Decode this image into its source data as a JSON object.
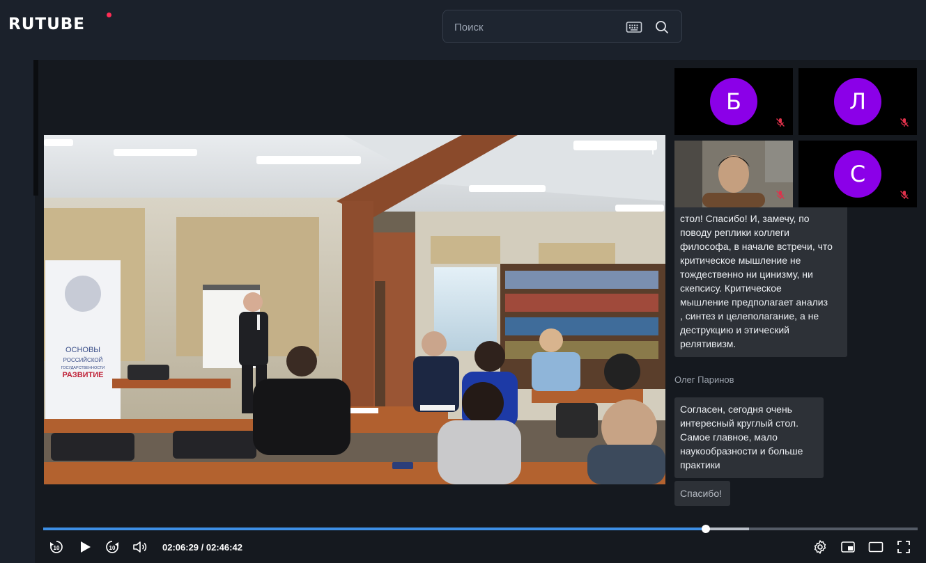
{
  "header": {
    "logo_text": "RUTUBE",
    "search_placeholder": "Поиск"
  },
  "participants": [
    {
      "initial": "Б",
      "muted": true
    },
    {
      "initial": "Л",
      "muted": true
    },
    {
      "initial": "",
      "muted": true,
      "has_video": true
    },
    {
      "initial": "С",
      "muted": true
    }
  ],
  "chat": {
    "messages": [
      {
        "lines": [
          "стол! Спасибо! И,  замечу, по",
          "поводу реплики коллеги",
          "философа, в начале встречи, что",
          "критическое мышление не",
          "тождественно ни цинизму, ни",
          "скепсису. Критическое",
          "мышление предполагает анализ",
          ", синтез и целеполагание, а не",
          "деструкцию и этический",
          "релятивизм."
        ]
      },
      {
        "sender": "Олег Паринов",
        "lines": [
          "Согласен, сегодня очень",
          "интересный круглый стол.",
          "Самое главное, мало",
          "наукообразности и больше",
          "практики"
        ]
      },
      {
        "lines": [
          "Спасибо!"
        ]
      }
    ]
  },
  "player": {
    "current_time": "02:06:29",
    "separator": " / ",
    "total_time": "02:46:42",
    "progress": 0.758,
    "buffered": 0.807,
    "skip_seconds": "10"
  },
  "video_banner": {
    "line1": "ОСНОВЫ",
    "line2": "РОССИЙСКОЙ",
    "line3": "ГОСУДАРСТВЕННОСТИ",
    "line4": "РАЗВИТИЕ"
  },
  "colors": {
    "accent": "#3d8fe5",
    "avatar": "#8b00e8",
    "logo_dot": "#ff2d55",
    "mic_muted": "#e0314b"
  }
}
